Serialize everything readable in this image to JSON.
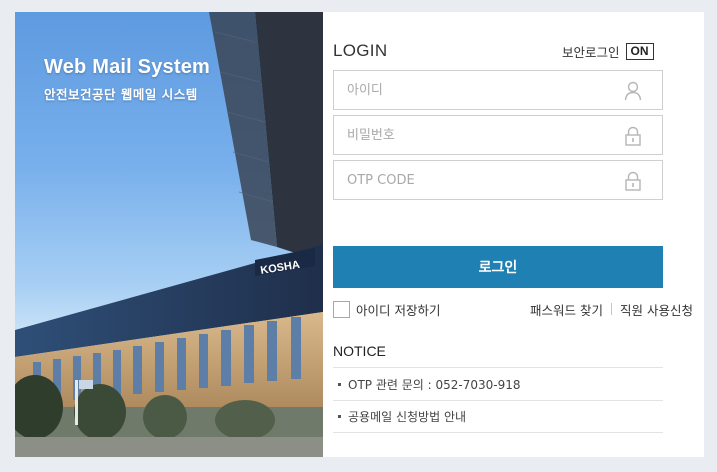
{
  "brand": {
    "title": "Web Mail System",
    "subtitle": "안전보건공단 웹메일 시스템",
    "building_sign": "KOSHA"
  },
  "login": {
    "title": "LOGIN",
    "secure_login_label": "보안로그인",
    "secure_login_state": "ON",
    "id_placeholder": "아이디",
    "password_placeholder": "비밀번호",
    "otp_placeholder": "OTP CODE",
    "submit_label": "로그인",
    "save_id_label": "아이디 저장하기",
    "save_id_checked": false,
    "find_password_label": "패스워드 찾기",
    "staff_signup_label": "직원 사용신청"
  },
  "notice": {
    "title": "NOTICE",
    "items": [
      "OTP 관련 문의 : 052-7030-918",
      "공용메일 신청방법 안내"
    ]
  },
  "colors": {
    "page_background": "#e9edf2",
    "primary_button": "#1f80b4",
    "input_border": "#cfcfcf"
  },
  "icons": {
    "id_field": "user-icon",
    "password_field": "lock-icon",
    "otp_field": "lock-icon"
  }
}
